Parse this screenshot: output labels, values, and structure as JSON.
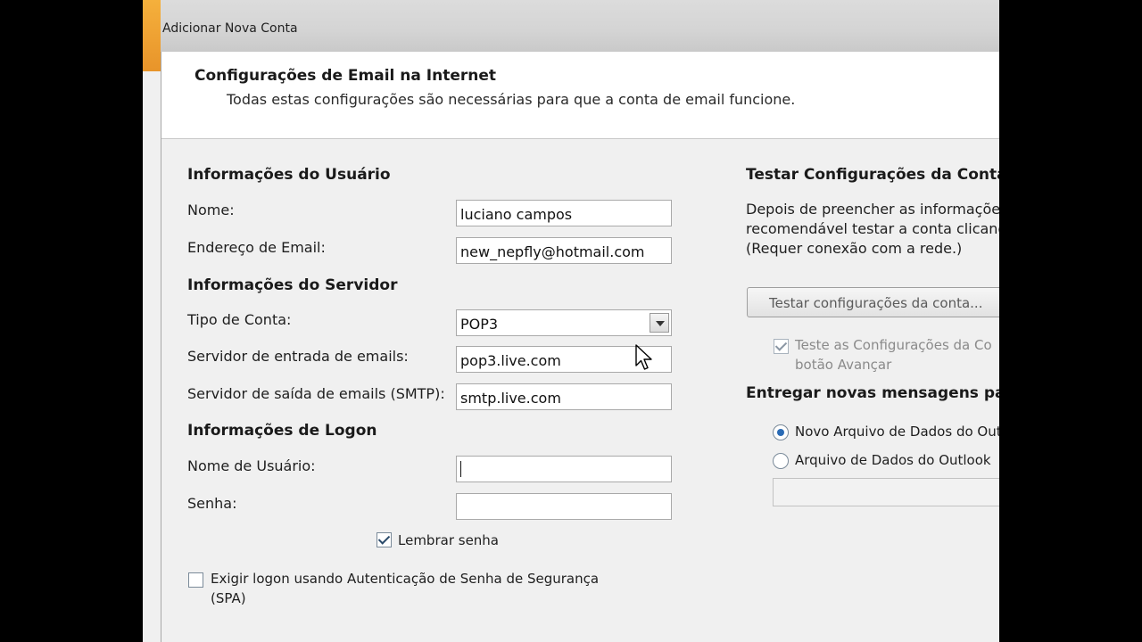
{
  "window": {
    "title": "Adicionar Nova Conta"
  },
  "header": {
    "title": "Configurações de Email na Internet",
    "subtitle": "Todas estas configurações são necessárias para que a conta de email funcione."
  },
  "user_info": {
    "title": "Informações do Usuário",
    "name_label": "Nome:",
    "name_value": "luciano campos",
    "email_label": "Endereço de Email:",
    "email_value": "new_nepfly@hotmail.com"
  },
  "server_info": {
    "title": "Informações do Servidor",
    "account_type_label": "Tipo de Conta:",
    "account_type_value": "POP3",
    "incoming_label": "Servidor de entrada de emails:",
    "incoming_value": "pop3.live.com",
    "outgoing_label": "Servidor de saída de emails (SMTP):",
    "outgoing_value": "smtp.live.com"
  },
  "logon_info": {
    "title": "Informações de Logon",
    "username_label": "Nome de Usuário:",
    "username_value": "",
    "password_label": "Senha:",
    "password_value": "",
    "remember_label": "Lembrar senha",
    "remember_checked": true,
    "spa_label_line1": "Exigir logon usando Autenticação de Senha de Segurança",
    "spa_label_line2": "(SPA)",
    "spa_checked": false
  },
  "test_settings": {
    "title": "Testar Configurações da Conta",
    "desc_line1": "Depois de preencher as informações",
    "desc_line2": "recomendável testar a conta clicand",
    "desc_line3": "(Requer conexão com a rede.)",
    "button_label": "Testar configurações da conta...",
    "auto_test_line1": "Teste as Configurações da Co",
    "auto_test_line2": "botão Avançar",
    "auto_test_checked": true
  },
  "deliver": {
    "title": "Entregar novas mensagens pa",
    "option_new": "Novo Arquivo de Dados do Out",
    "option_existing": "Arquivo de Dados do Outlook",
    "selected": "option_new"
  }
}
